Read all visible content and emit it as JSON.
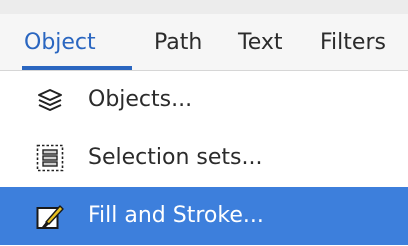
{
  "menubar": {
    "items": [
      {
        "label": "Object",
        "active": true
      },
      {
        "label": "Path",
        "active": false
      },
      {
        "label": "Text",
        "active": false
      },
      {
        "label": "Filters",
        "active": false
      }
    ]
  },
  "dropdown": {
    "items": [
      {
        "label": "Objects...",
        "icon": "objects-layers-icon",
        "highlighted": false
      },
      {
        "label": "Selection sets...",
        "icon": "selection-sets-icon",
        "highlighted": false
      },
      {
        "label": "Fill and Stroke...",
        "icon": "fill-stroke-brush-icon",
        "highlighted": true
      }
    ]
  },
  "colors": {
    "accent": "#2a66c0",
    "highlight": "#3d7fdc",
    "menubar_bg": "#f6f6f6",
    "text": "#2b2b2b"
  }
}
